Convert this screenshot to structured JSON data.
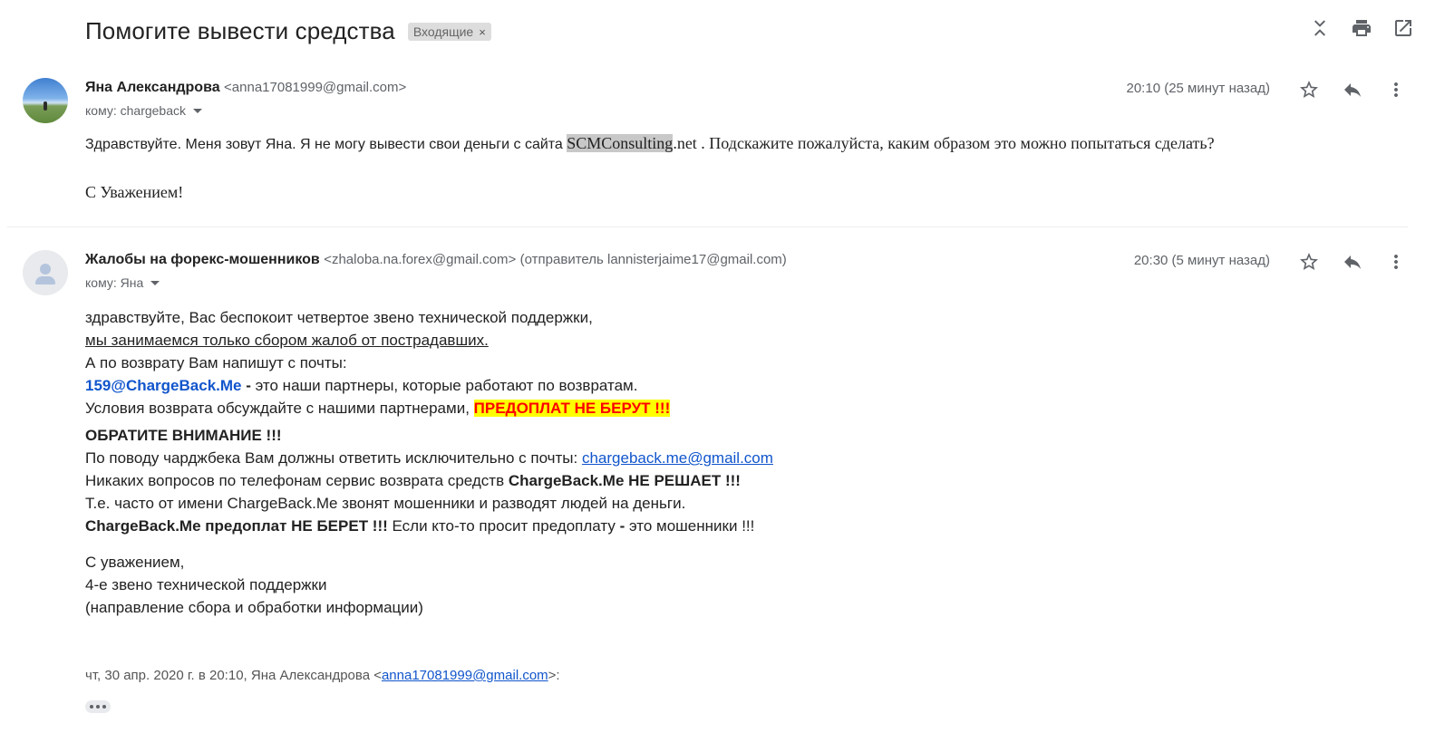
{
  "thread": {
    "subject": "Помогите вывести средства",
    "label": "Входящие",
    "label_remove": "×"
  },
  "message1": {
    "sender_name": "Яна Александрова",
    "sender_email": "<anna17081999@gmail.com>",
    "to_label": "кому: chargeback",
    "time": "20:10 (25 минут назад)",
    "body_part1": "Здравствуйте. Меня зовут Яна. Я не могу вывести свои деньги с сайта ",
    "body_site": "SCMConsulting",
    "body_part2": ".net . Подскажите пожалуйста, каким образом это можно попытаться сделать?",
    "signoff": "С Уважением!"
  },
  "message2": {
    "sender_name": "Жалобы на форекс-мошенников",
    "sender_email": "<zhaloba.na.forex@gmail.com>",
    "sender_via": "(отправитель lannisterjaime17@gmail.com)",
    "to_label": "кому: Яна",
    "time": "20:30 (5 минут назад)",
    "line1": "здравствуйте, Вас беспокоит четвертое звено технической поддержки,",
    "line2": "мы занимаемся только сбором жалоб от пострадавших.",
    "line3": "А по возврату Вам напишут с почты:",
    "line4_email": "159@ChargeBack.Me",
    "line4_dash": " - ",
    "line4_rest": "это наши партнеры, которые работают по возвратам.",
    "line5_a": "Условия возврата обсуждайте с нашими партнерами, ",
    "line5_b": "ПРЕДОПЛАТ НЕ БЕРУТ !!!",
    "line6": "ОБРАТИТЕ ВНИМАНИЕ !!!",
    "line7_a": "По поводу чарджбека Вам должны ответить исключительно с почты: ",
    "line7_link": "chargeback.me@gmail.com",
    "line8_a": "Никаких вопросов по телефонам сервис возврата средств ",
    "line8_b": "ChargeBack.Me НЕ РЕШАЕТ !!!",
    "line9": "Т.е. часто от имени ChargeBack.Me звонят мошенники и разводят людей на деньги.",
    "line10_a": "ChargeBack.Me предоплат НЕ БЕРЕТ !!!",
    "line10_b": " Если кто-то просит предоплату ",
    "line10_c": "-",
    "line10_d": " это мошенники !!!",
    "sig1": "С уважением,",
    "sig2": "4-е звено технической поддержки",
    "sig3": "(направление сбора и обработки информации)",
    "quote_prefix": "чт, 30 апр. 2020 г. в 20:10, Яна Александрова <",
    "quote_email": "anna17081999@gmail.com",
    "quote_suffix": ">:"
  },
  "icons": {
    "collapse": "collapse-all-icon",
    "print": "print-icon",
    "open_new": "open-in-new-window-icon",
    "star": "star-icon",
    "reply": "reply-icon",
    "more": "more-vert-icon"
  }
}
